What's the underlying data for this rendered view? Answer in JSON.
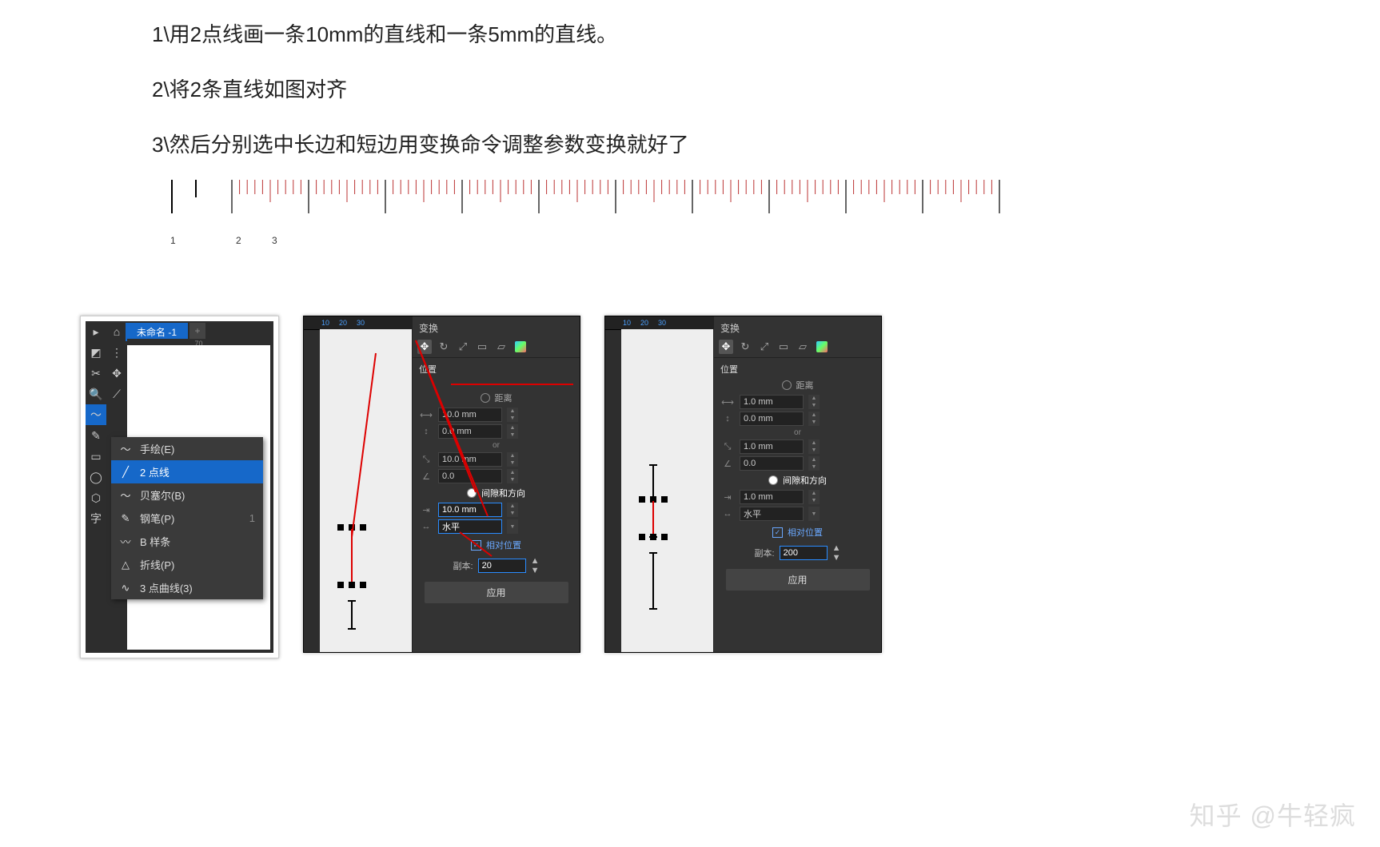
{
  "instructions": {
    "line1": "1\\用2点线画一条10mm的直线和一条5mm的直线。",
    "line2": "2\\将2条直线如图对齐",
    "line3": "3\\然后分别选中长边和短边用变换命令调整参数变换就好了"
  },
  "ruler": {
    "labels": [
      "1",
      "2",
      "3"
    ],
    "long_line_mm": 10,
    "short_line_mm": 5,
    "tick_count": 100
  },
  "panel_tools": {
    "tab_title": "未命名 -1",
    "ruler_mark": "70",
    "flyout": [
      {
        "icon": "～",
        "label": "手绘(E)",
        "shortcut": ""
      },
      {
        "icon": "╱",
        "label": "2 点线",
        "shortcut": "",
        "selected": true
      },
      {
        "icon": "〜",
        "label": "贝塞尔(B)",
        "shortcut": ""
      },
      {
        "icon": "✎",
        "label": "钢笔(P)",
        "shortcut": "1"
      },
      {
        "icon": "〰",
        "label": "B 样条",
        "shortcut": ""
      },
      {
        "icon": "△",
        "label": "折线(P)",
        "shortcut": ""
      },
      {
        "icon": "∿",
        "label": "3 点曲线(3)",
        "shortcut": ""
      }
    ]
  },
  "panel_transform_A": {
    "title": "变换",
    "section": "位置",
    "radio_distance": "距离",
    "dist_h": "10.0 mm",
    "dist_v": "0.0 mm",
    "or": "or",
    "angle_len": "10.0 mm",
    "angle_deg": "0.0",
    "radio_gap": "间隙和方向",
    "gap_value": "10.0 mm",
    "direction": "水平",
    "relative": "相对位置",
    "copies_label": "副本:",
    "copies_value": "20",
    "apply": "应用",
    "ruler_ticks": [
      "10",
      "20",
      "30"
    ]
  },
  "panel_transform_B": {
    "title": "变换",
    "section": "位置",
    "radio_distance": "距离",
    "dist_h": "1.0 mm",
    "dist_v": "0.0 mm",
    "or": "or",
    "angle_len": "1.0 mm",
    "angle_deg": "0.0",
    "radio_gap": "间隙和方向",
    "gap_value": "1.0 mm",
    "direction": "水平",
    "relative": "相对位置",
    "copies_label": "副本:",
    "copies_value": "200",
    "apply": "应用",
    "ruler_ticks": [
      "10",
      "20",
      "30"
    ]
  },
  "watermark": "知乎 @牛轻疯"
}
